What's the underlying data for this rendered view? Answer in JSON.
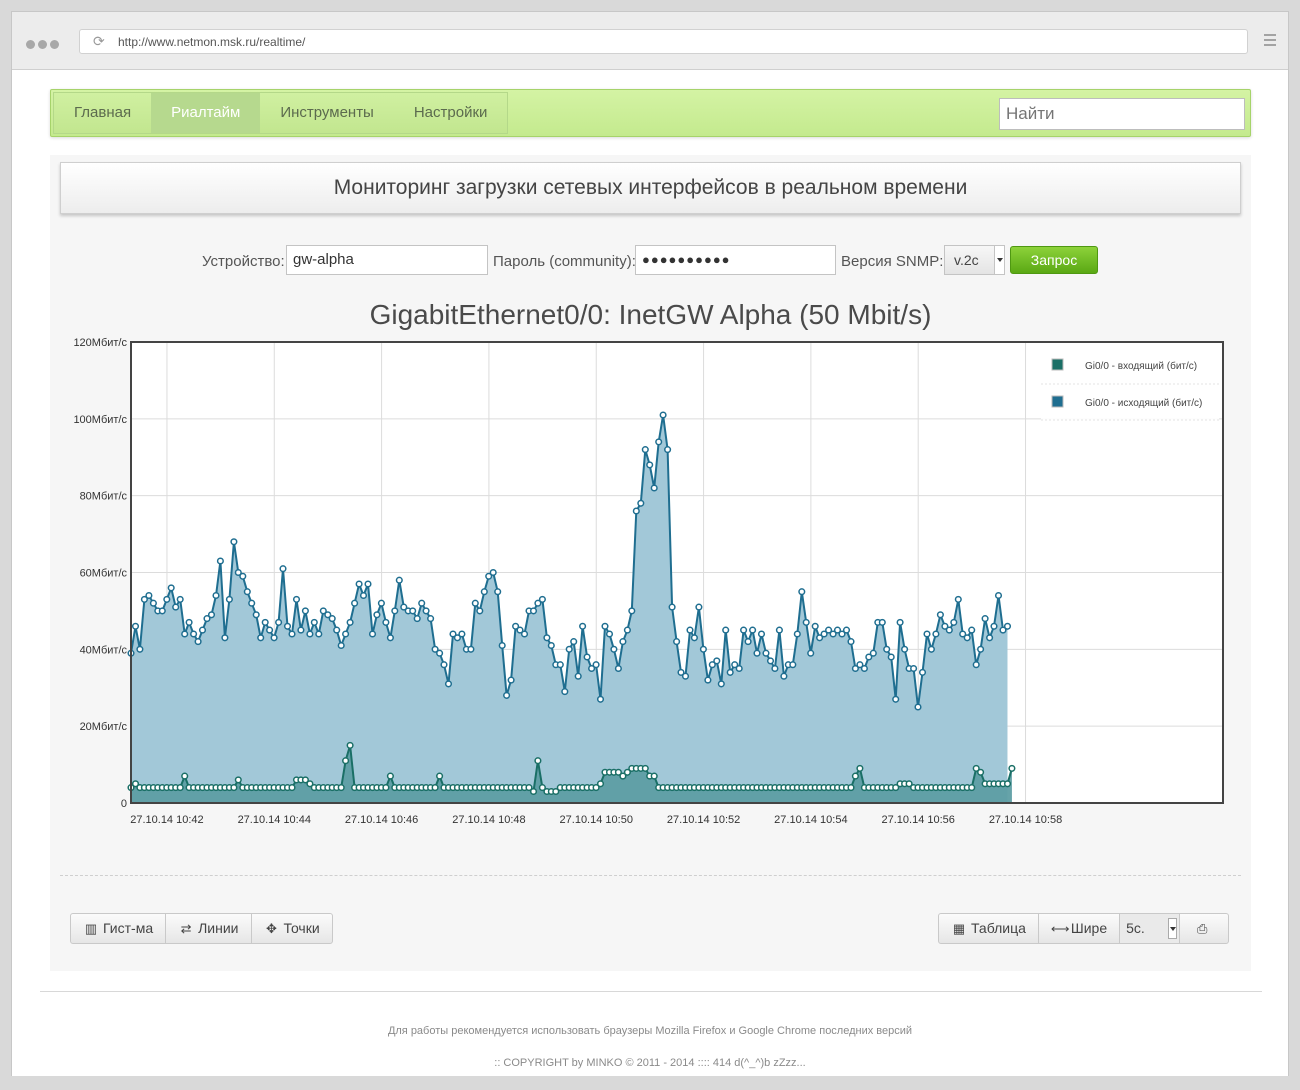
{
  "browser": {
    "url": "http://www.netmon.msk.ru/realtime/"
  },
  "nav": {
    "items": [
      {
        "label": "Главная",
        "active": false
      },
      {
        "label": "Риалтайм",
        "active": true
      },
      {
        "label": "Инструменты",
        "active": false
      },
      {
        "label": "Настройки",
        "active": false
      }
    ],
    "search_placeholder": "Найти"
  },
  "header": {
    "title": "Мониторинг загрузки сетевых интерфейсов в реальном времени"
  },
  "form": {
    "device_label": "Устройство:",
    "device_value": "gw-alpha",
    "password_label": "Пароль (community):",
    "password_value": "●●●●●●●●●●",
    "snmp_label": "Версия SNMP:",
    "snmp_value": "v.2c",
    "submit_label": "Запрос"
  },
  "chart_title": "GigabitEthernet0/0: InetGW Alpha (50 Mbit/s)",
  "chart_data": {
    "type": "area",
    "title": "GigabitEthernet0/0: InetGW Alpha (50 Mbit/s)",
    "ylim": [
      0,
      120
    ],
    "yticks": [
      {
        "value": 0,
        "label": "0"
      },
      {
        "value": 20,
        "label": "20Мбит/с"
      },
      {
        "value": 40,
        "label": "40Мбит/с"
      },
      {
        "value": 60,
        "label": "60Мбит/с"
      },
      {
        "value": 80,
        "label": "80Мбит/с"
      },
      {
        "value": 100,
        "label": "100Мбит/с"
      },
      {
        "value": 120,
        "label": "120Мбит/с"
      }
    ],
    "x_start": "27.10.14 10:41:20",
    "x_step_seconds": 5,
    "x_range_minutes": [
      0,
      20.35
    ],
    "xticks": [
      {
        "minute": 0.67,
        "label": "27.10.14 10:42"
      },
      {
        "minute": 2.67,
        "label": "27.10.14 10:44"
      },
      {
        "minute": 4.67,
        "label": "27.10.14 10:46"
      },
      {
        "minute": 6.67,
        "label": "27.10.14 10:48"
      },
      {
        "minute": 8.67,
        "label": "27.10.14 10:50"
      },
      {
        "minute": 10.67,
        "label": "27.10.14 10:52"
      },
      {
        "minute": 12.67,
        "label": "27.10.14 10:54"
      },
      {
        "minute": 14.67,
        "label": "27.10.14 10:56"
      },
      {
        "minute": 16.67,
        "label": "27.10.14 10:58"
      }
    ],
    "legend_position": "top-right",
    "grid": true,
    "series": [
      {
        "name": "Gi0/0 - входящий (бит/с)",
        "color": "#1a6f66",
        "fill": "#5e9ea4",
        "values": [
          4,
          5,
          4,
          4,
          4,
          4,
          4,
          4,
          4,
          4,
          4,
          4,
          7,
          4,
          4,
          4,
          4,
          4,
          4,
          4,
          4,
          4,
          4,
          4,
          6,
          4,
          4,
          4,
          4,
          4,
          4,
          4,
          4,
          4,
          4,
          4,
          4,
          6,
          6,
          6,
          5,
          4,
          4,
          4,
          4,
          4,
          4,
          4,
          11,
          15,
          4,
          4,
          4,
          4,
          4,
          4,
          4,
          4,
          7,
          4,
          4,
          4,
          4,
          4,
          4,
          4,
          4,
          4,
          4,
          7,
          4,
          4,
          4,
          4,
          4,
          4,
          4,
          4,
          4,
          4,
          4,
          4,
          4,
          4,
          4,
          4,
          4,
          4,
          4,
          4,
          3,
          11,
          4,
          3,
          3,
          3,
          4,
          4,
          4,
          4,
          4,
          4,
          4,
          4,
          4,
          5,
          8,
          8,
          8,
          8,
          7,
          8,
          9,
          9,
          9,
          9,
          7,
          7,
          4,
          4,
          4,
          4,
          4,
          4,
          4,
          4,
          4,
          4,
          4,
          4,
          4,
          4,
          4,
          4,
          4,
          4,
          4,
          4,
          4,
          4,
          4,
          4,
          4,
          4,
          4,
          4,
          4,
          4,
          4,
          4,
          4,
          4,
          4,
          4,
          4,
          4,
          4,
          4,
          4,
          4,
          4,
          4,
          7,
          9,
          4,
          4,
          4,
          4,
          4,
          4,
          4,
          4,
          5,
          5,
          5,
          4,
          4,
          4,
          4,
          4,
          4,
          4,
          4,
          4,
          4,
          4,
          4,
          4,
          4,
          9,
          8,
          5,
          5,
          5,
          5,
          5,
          5,
          9
        ]
      },
      {
        "name": "Gi0/0 - исходящий (бит/с)",
        "color": "#1f6e90",
        "fill": "#a2c8d8",
        "values": [
          39,
          46,
          40,
          53,
          54,
          52,
          50,
          50,
          53,
          56,
          51,
          53,
          44,
          47,
          44,
          42,
          45,
          48,
          49,
          54,
          63,
          43,
          53,
          68,
          60,
          59,
          55,
          52,
          49,
          43,
          47,
          45,
          43,
          47,
          61,
          46,
          44,
          53,
          45,
          50,
          44,
          47,
          44,
          50,
          49,
          48,
          45,
          41,
          44,
          47,
          52,
          57,
          54,
          57,
          44,
          49,
          52,
          47,
          43,
          50,
          58,
          51,
          50,
          50,
          48,
          52,
          50,
          48,
          40,
          39,
          36,
          31,
          44,
          43,
          44,
          40,
          40,
          52,
          50,
          55,
          59,
          60,
          55,
          41,
          28,
          32,
          46,
          45,
          44,
          50,
          50,
          52,
          53,
          43,
          41,
          36,
          36,
          29,
          40,
          42,
          33,
          46,
          38,
          35,
          36,
          27,
          46,
          44,
          40,
          35,
          42,
          45,
          50,
          76,
          78,
          92,
          88,
          82,
          94,
          101,
          92,
          51,
          42,
          34,
          33,
          45,
          43,
          51,
          40,
          32,
          36,
          37,
          31,
          45,
          34,
          36,
          35,
          45,
          42,
          45,
          39,
          44,
          39,
          37,
          35,
          45,
          33,
          36,
          36,
          44,
          55,
          47,
          39,
          46,
          43,
          44,
          45,
          44,
          45,
          44,
          45,
          42,
          35,
          36,
          35,
          38,
          39,
          47,
          47,
          40,
          38,
          27,
          47,
          40,
          35,
          35,
          25,
          34,
          44,
          40,
          44,
          49,
          46,
          45,
          47,
          53,
          44,
          43,
          45,
          36,
          40,
          48,
          43,
          46,
          54,
          45,
          46
        ]
      }
    ]
  },
  "toolbar_left": [
    {
      "icon": "bar-chart-icon",
      "glyph": "▥",
      "label": "Гист-ма"
    },
    {
      "icon": "swap-icon",
      "glyph": "⇄",
      "label": "Линии"
    },
    {
      "icon": "crosshair-icon",
      "glyph": "✥",
      "label": "Точки"
    }
  ],
  "toolbar_right": {
    "table_label": "Таблица",
    "table_glyph": "▦",
    "wider_label": "Шире",
    "wider_glyph": "⟷",
    "interval_value": "5с.",
    "save_glyph": "⎙"
  },
  "footer": {
    "line1": "Для работы рекомендуется использовать браузеры Mozilla Firefox и Google Chrome последних версий",
    "line2": ":: COPYRIGHT by MINKO © 2011 - 2014 :::: 414 d(^_^)b zZzz..."
  }
}
